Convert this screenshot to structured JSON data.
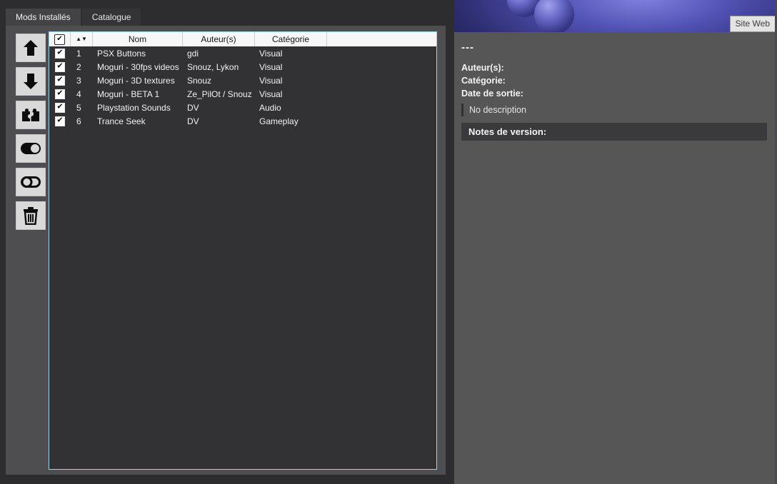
{
  "tabs": [
    {
      "label": "Mods Installés",
      "active": true
    },
    {
      "label": "Catalogue",
      "active": false
    }
  ],
  "toolbar": {
    "buttons": [
      {
        "name": "move-up-button",
        "icon": "arrow-up-icon"
      },
      {
        "name": "move-down-button",
        "icon": "arrow-down-icon"
      },
      {
        "name": "conflicts-button",
        "icon": "puzzle-pieces-icon"
      },
      {
        "name": "enable-all-button",
        "icon": "toggle-on-icon"
      },
      {
        "name": "disable-all-button",
        "icon": "toggle-off-icon"
      },
      {
        "name": "delete-mod-button",
        "icon": "trash-icon"
      }
    ]
  },
  "icons": {
    "check": "✔",
    "sort_up": "▲",
    "sort_down": "▼"
  },
  "table": {
    "headers": {
      "name": "Nom",
      "authors": "Auteur(s)",
      "category": "Catégorie"
    },
    "header_checkbox_checked": true,
    "rows": [
      {
        "checked": true,
        "num": "1",
        "name": "PSX Buttons",
        "authors": "gdi",
        "category": "Visual"
      },
      {
        "checked": true,
        "num": "2",
        "name": "Moguri - 30fps videos",
        "authors": "Snouz, Lykon",
        "category": "Visual"
      },
      {
        "checked": true,
        "num": "3",
        "name": "Moguri - 3D textures",
        "authors": "Snouz",
        "category": "Visual"
      },
      {
        "checked": true,
        "num": "4",
        "name": "Moguri - BETA 1",
        "authors": "Ze_PilOt / Snouz",
        "category": "Visual"
      },
      {
        "checked": true,
        "num": "5",
        "name": "Playstation Sounds",
        "authors": "DV",
        "category": "Audio"
      },
      {
        "checked": true,
        "num": "6",
        "name": "Trance Seek",
        "authors": "DV",
        "category": "Gameplay"
      }
    ]
  },
  "details": {
    "website_button": "Site Web",
    "title": "---",
    "authors_label": "Auteur(s):",
    "category_label": "Catégorie:",
    "release_date_label": "Date de sortie:",
    "description": "No description",
    "release_notes_label": "Notes de version:"
  },
  "colors": {
    "window_bg": "#2d2d30",
    "page_bg": "#4e4e51",
    "table_bg": "#323235",
    "table_border": "#9bd2ee",
    "header_bg": "#f7f7f7",
    "right_panel_bg": "#565656",
    "notes_bar_bg": "#3a3a3c",
    "banner_glow": "#8282e2",
    "toolbar_button_bg": "#d9d9d9"
  }
}
